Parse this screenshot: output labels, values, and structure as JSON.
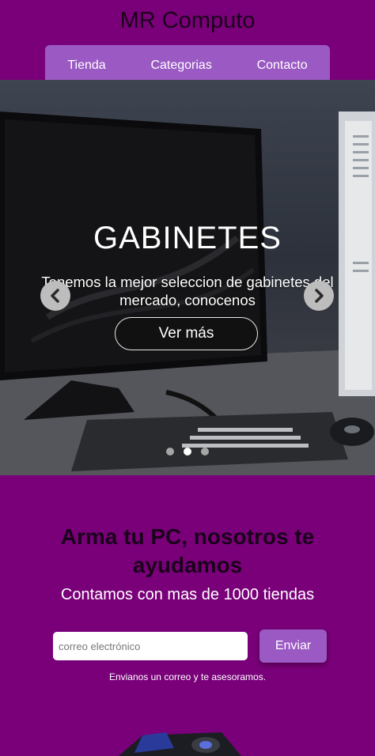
{
  "brand": "MR Computo",
  "nav": {
    "items": [
      "Tienda",
      "Categorias",
      "Contacto"
    ]
  },
  "hero": {
    "title": "GABINETES",
    "text": "Tenemos la mejor seleccion de gabinetes del mercado, conocenos",
    "button": "Ver más",
    "prev_icon": "chevron-left-icon",
    "next_icon": "chevron-right-icon",
    "slide_count": 3,
    "active_slide": 2
  },
  "cta": {
    "title": "Arma tu PC, nosotros te ayudamos",
    "subtitle": "Contamos con mas de 1000 tiendas",
    "email_placeholder": "correo electrónico",
    "email_value": "",
    "send_button": "Enviar",
    "note": "Envianos un correo y te asesoramos."
  },
  "colors": {
    "background": "#7a007a",
    "nav": "#9b59c4",
    "button": "#9b59c4"
  }
}
